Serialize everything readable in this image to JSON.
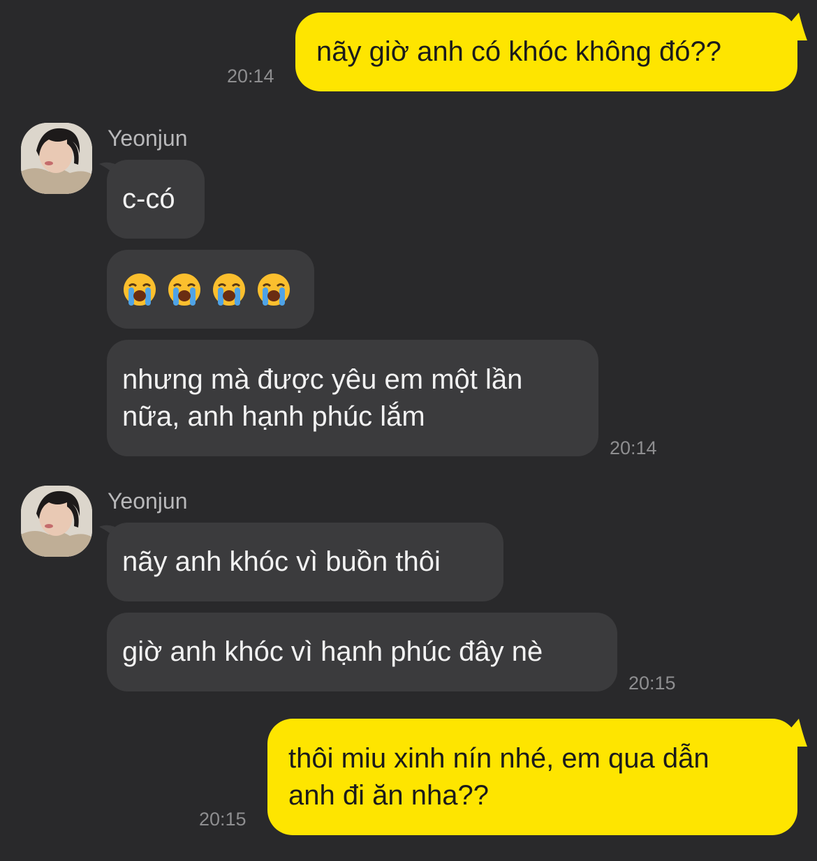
{
  "messages": {
    "m1": {
      "text": "nãy giờ anh có khóc không đó??",
      "time": "20:14"
    },
    "g1": {
      "sender": "Yeonjun"
    },
    "m2": {
      "text": "c-có"
    },
    "m3": {
      "emoji": [
        "loudly-crying-face",
        "loudly-crying-face",
        "loudly-crying-face",
        "loudly-crying-face"
      ]
    },
    "m4": {
      "text": "nhưng mà được yêu em một lần\nnữa, anh hạnh phúc lắm",
      "time": "20:14"
    },
    "g2": {
      "sender": "Yeonjun"
    },
    "m5": {
      "text": "nãy anh khóc vì buồn thôi"
    },
    "m6": {
      "text": "giờ anh khóc vì hạnh phúc đây nè",
      "time": "20:15"
    },
    "m7": {
      "text": "thôi miu xinh nín nhé, em qua dẫn\nanh đi ăn nha??",
      "time": "20:15"
    }
  },
  "colors": {
    "background": "#29292b",
    "my_bubble": "#fee500",
    "their_bubble": "#3b3b3d",
    "timestamp": "#8e8e90"
  }
}
